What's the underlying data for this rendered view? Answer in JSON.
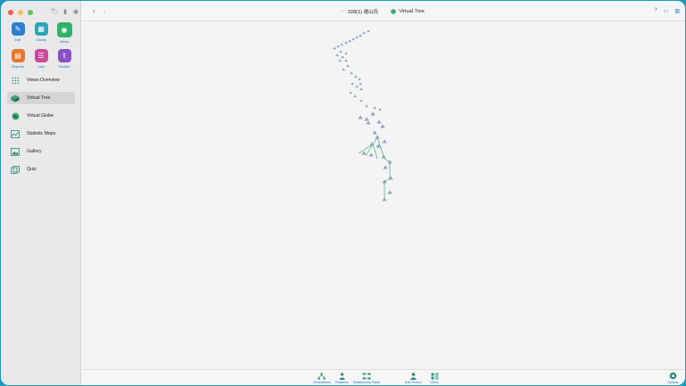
{
  "window": {
    "title": "328(1) 遠山氏",
    "view_name": "Virtual Tree"
  },
  "modules": [
    {
      "label": "Edit",
      "color": "#2b7fd6"
    },
    {
      "label": "Charts",
      "color": "#2aa7b8"
    },
    {
      "label": "Views",
      "color": "#2fb36a"
    },
    {
      "label": "Reports",
      "color": "#e8762e"
    },
    {
      "label": "Lists",
      "color": "#c94a9a"
    },
    {
      "label": "Publish",
      "color": "#8a52c8"
    }
  ],
  "sidebar": {
    "items": [
      {
        "label": "Views Overview",
        "icon": "grid-icon"
      },
      {
        "label": "Virtual Tree",
        "icon": "cube-tree-icon"
      },
      {
        "label": "Virtual Globe",
        "icon": "globe-icon"
      },
      {
        "label": "Statistic Maps",
        "icon": "map-icon"
      },
      {
        "label": "Gallery",
        "icon": "image-icon"
      },
      {
        "label": "Quiz",
        "icon": "quiz-icon"
      }
    ]
  },
  "bottombar": {
    "buttons": [
      {
        "label": "Generations",
        "icon": "generations-icon"
      },
      {
        "label": "Relatives",
        "icon": "relatives-icon"
      },
      {
        "label": "Relationship Paths",
        "icon": "relationship-paths-icon"
      },
      {
        "label": "Edit Person",
        "icon": "person-icon"
      },
      {
        "label": "Views",
        "icon": "views-icon"
      },
      {
        "label": "Options",
        "icon": "gear-icon"
      }
    ]
  },
  "colors": {
    "accent": "#1a73c8",
    "tree_node": "#8fa3c0",
    "tree_link": "#3aa876"
  }
}
